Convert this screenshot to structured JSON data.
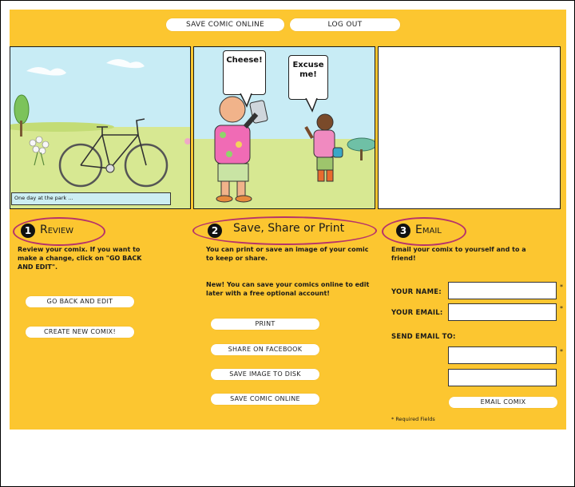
{
  "top_buttons": {
    "save_online": "SAVE COMIC ONLINE",
    "log_out": "LOG OUT"
  },
  "comic": {
    "panel1_caption": "One day at the park ...",
    "panel2_bubble_left": "Cheese!",
    "panel2_bubble_right": "Excuse me!"
  },
  "review": {
    "number": "1",
    "title": "Review",
    "text": "Review your comix. If you want to make a change, click on \"GO BACK AND EDIT\".",
    "go_back": "GO BACK AND EDIT",
    "create_new": "CREATE NEW COMIX!"
  },
  "share": {
    "number": "2",
    "title": "Save, Share or Print",
    "text": "You can print or save an image of your comic to keep or share.",
    "text2": "New! You can save your comics online to edit later with a free optional account!",
    "print": "PRINT",
    "facebook": "SHARE ON FACEBOOK",
    "save_disk": "SAVE IMAGE TO DISK",
    "save_online": "SAVE COMIC ONLINE"
  },
  "email": {
    "number": "3",
    "title": "Email",
    "text": "Email your comix to yourself and to a friend!",
    "your_name": "YOUR NAME:",
    "your_email": "YOUR EMAIL:",
    "send_to": "SEND EMAIL TO:",
    "button": "EMAIL COMIX",
    "required": "* Required Fields",
    "asterisk": "*"
  },
  "colors": {
    "background": "#fcc630",
    "highlight_oval": "#b7336a"
  }
}
